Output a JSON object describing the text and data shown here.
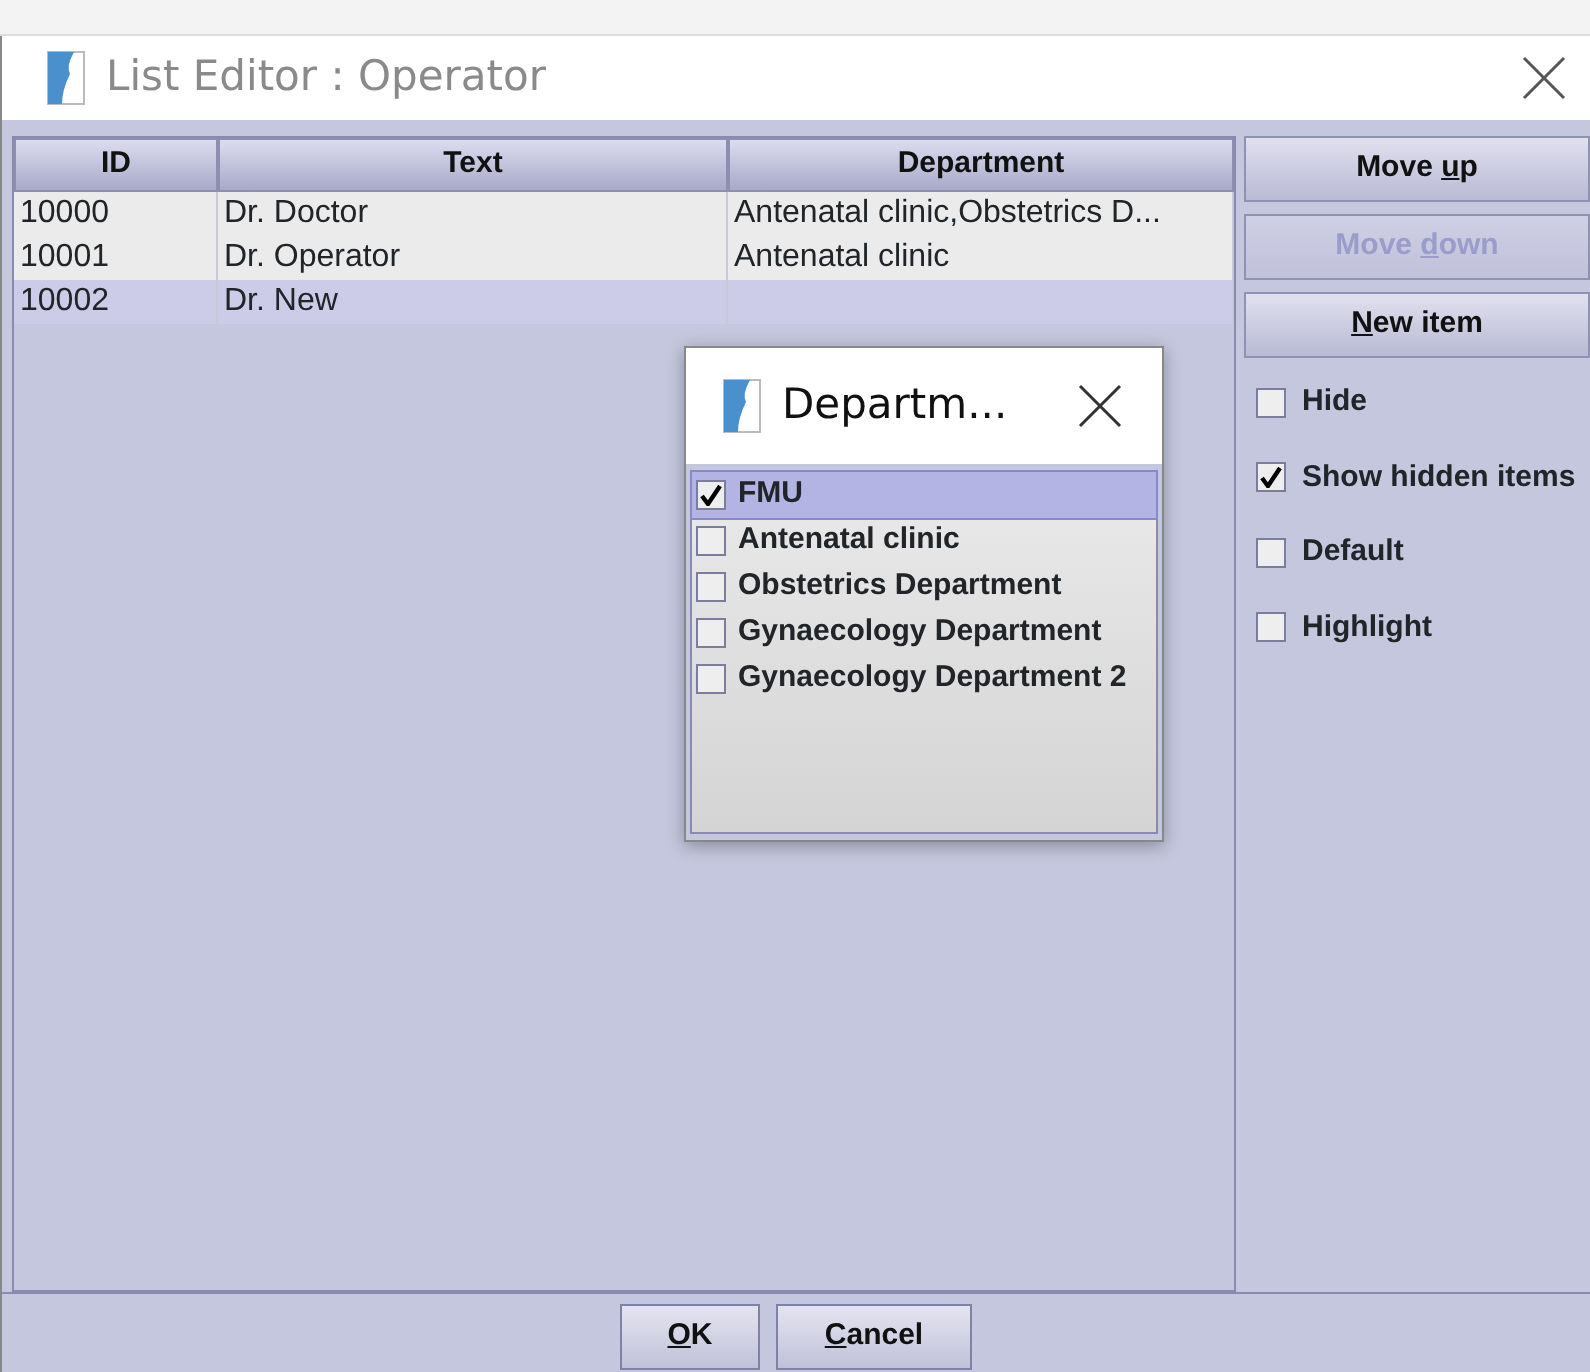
{
  "window": {
    "title": "List Editor : Operator"
  },
  "table": {
    "columns": [
      "ID",
      "Text",
      "Department"
    ],
    "rows": [
      {
        "cells": [
          "10000",
          "Dr. Doctor",
          "Antenatal clinic,Obstetrics D..."
        ],
        "selected": false
      },
      {
        "cells": [
          "10001",
          "Dr. Operator",
          "Antenatal clinic"
        ],
        "selected": false
      },
      {
        "cells": [
          "10002",
          "Dr. New",
          ""
        ],
        "selected": true
      }
    ]
  },
  "side_buttons": [
    {
      "parts": [
        {
          "text": "Move "
        },
        {
          "text": "u",
          "underlined": true
        },
        {
          "text": "p"
        }
      ],
      "disabled": false
    },
    {
      "parts": [
        {
          "text": "Move "
        },
        {
          "text": "d",
          "underlined": true
        },
        {
          "text": "own"
        }
      ],
      "disabled": true
    },
    {
      "parts": [
        {
          "text": "N",
          "underlined": true
        },
        {
          "text": "ew item"
        }
      ],
      "disabled": false
    }
  ],
  "options": [
    {
      "label": "Hide",
      "checked": false
    },
    {
      "label": "Show hidden items",
      "checked": true
    },
    {
      "label": "Default",
      "checked": false
    },
    {
      "label": "Highlight",
      "checked": false
    }
  ],
  "popup": {
    "title": "Departm...",
    "items": [
      {
        "label": "FMU",
        "checked": true,
        "selected": true
      },
      {
        "label": "Antenatal clinic",
        "checked": false,
        "selected": false
      },
      {
        "label": "Obstetrics Department",
        "checked": false,
        "selected": false
      },
      {
        "label": "Gynaecology Department",
        "checked": false,
        "selected": false
      },
      {
        "label": "Gynaecology Department 2",
        "checked": false,
        "selected": false
      }
    ]
  },
  "footer_buttons": [
    {
      "parts": [
        {
          "text": "O",
          "underlined": true
        },
        {
          "text": "K"
        }
      ]
    },
    {
      "parts": [
        {
          "text": "C",
          "underlined": true
        },
        {
          "text": "ancel"
        }
      ]
    }
  ]
}
